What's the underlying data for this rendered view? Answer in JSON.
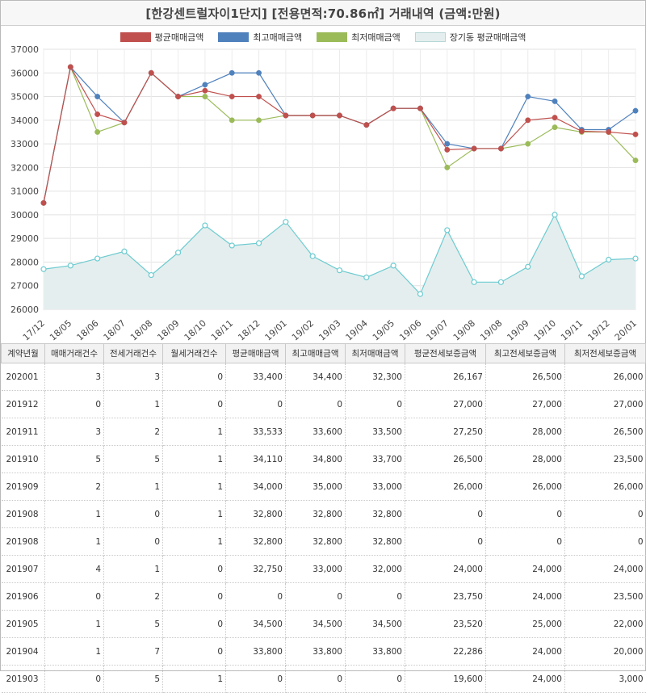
{
  "title": "[한강센트럴자이1단지] [전용면적:70.86㎡] 거래내역 (금액:만원)",
  "colors": {
    "avg_sale": "#c0504d",
    "max_sale": "#4f81bd",
    "min_sale": "#9bbb59",
    "lease_avg": "#6ccbd0",
    "lease_fill": "#e5eeee"
  },
  "chart_data": {
    "type": "line",
    "categories": [
      "17/12",
      "18/05",
      "18/06",
      "18/07",
      "18/08",
      "18/09",
      "18/10",
      "18/11",
      "18/12",
      "19/01",
      "19/02",
      "19/03",
      "19/04",
      "19/05",
      "19/06",
      "19/07",
      "19/08",
      "19/08",
      "19/09",
      "19/10",
      "19/11",
      "19/12",
      "20/01"
    ],
    "ylim": [
      26000,
      37000
    ],
    "yticks": [
      "26000",
      "27000",
      "28000",
      "29000",
      "30000",
      "31000",
      "32000",
      "33000",
      "34000",
      "35000",
      "36000",
      "37000"
    ],
    "grid": true,
    "legend_position": "top",
    "series": [
      {
        "name": "평균매매금액",
        "type": "line",
        "values": [
          30500,
          36250,
          34250,
          33900,
          36000,
          35000,
          35250,
          35000,
          35000,
          34200,
          34200,
          34200,
          33800,
          34500,
          34500,
          32750,
          32800,
          32800,
          34000,
          34110,
          33533,
          33500,
          33400
        ]
      },
      {
        "name": "최고매매금액",
        "type": "line",
        "values": [
          30500,
          36250,
          35000,
          33900,
          36000,
          35000,
          35500,
          36000,
          36000,
          34200,
          34200,
          34200,
          33800,
          34500,
          34500,
          33000,
          32800,
          32800,
          35000,
          34800,
          33600,
          33600,
          34400
        ]
      },
      {
        "name": "최저매매금액",
        "type": "line",
        "values": [
          30500,
          36250,
          33500,
          33900,
          36000,
          35000,
          35000,
          34000,
          34000,
          34200,
          34200,
          34200,
          33800,
          34500,
          34500,
          32000,
          32800,
          32800,
          33000,
          33700,
          33500,
          33500,
          32300
        ]
      },
      {
        "name": "장기동 평균매매금액",
        "type": "area",
        "values": [
          27700,
          27850,
          28150,
          28450,
          27450,
          28400,
          29550,
          28700,
          28800,
          29700,
          28250,
          27650,
          27350,
          27850,
          26650,
          29350,
          27150,
          27150,
          27800,
          30000,
          27400,
          28100,
          28150
        ]
      }
    ]
  },
  "table": {
    "headers": [
      "계약년월",
      "매매거래건수",
      "전세거래건수",
      "월세거래건수",
      "평균매매금액",
      "최고매매금액",
      "최저매매금액",
      "평균전세보증금액",
      "최고전세보증금액",
      "최저전세보증금액"
    ],
    "rows": [
      [
        "202001",
        "3",
        "3",
        "0",
        "33,400",
        "34,400",
        "32,300",
        "26,167",
        "26,500",
        "26,000"
      ],
      [
        "201912",
        "0",
        "1",
        "0",
        "0",
        "0",
        "0",
        "27,000",
        "27,000",
        "27,000"
      ],
      [
        "201911",
        "3",
        "2",
        "1",
        "33,533",
        "33,600",
        "33,500",
        "27,250",
        "28,000",
        "26,500"
      ],
      [
        "201910",
        "5",
        "5",
        "1",
        "34,110",
        "34,800",
        "33,700",
        "26,500",
        "28,000",
        "23,500"
      ],
      [
        "201909",
        "2",
        "1",
        "1",
        "34,000",
        "35,000",
        "33,000",
        "26,000",
        "26,000",
        "26,000"
      ],
      [
        "201908",
        "1",
        "0",
        "1",
        "32,800",
        "32,800",
        "32,800",
        "0",
        "0",
        "0"
      ],
      [
        "201908",
        "1",
        "0",
        "1",
        "32,800",
        "32,800",
        "32,800",
        "0",
        "0",
        "0"
      ],
      [
        "201907",
        "4",
        "1",
        "0",
        "32,750",
        "33,000",
        "32,000",
        "24,000",
        "24,000",
        "24,000"
      ],
      [
        "201906",
        "0",
        "2",
        "0",
        "0",
        "0",
        "0",
        "23,750",
        "24,000",
        "23,500"
      ],
      [
        "201905",
        "1",
        "5",
        "0",
        "34,500",
        "34,500",
        "34,500",
        "23,520",
        "25,000",
        "22,000"
      ],
      [
        "201904",
        "1",
        "7",
        "0",
        "33,800",
        "33,800",
        "33,800",
        "22,286",
        "24,000",
        "20,000"
      ],
      [
        "201903",
        "0",
        "5",
        "1",
        "0",
        "0",
        "0",
        "19,600",
        "24,000",
        "3,000"
      ]
    ]
  }
}
